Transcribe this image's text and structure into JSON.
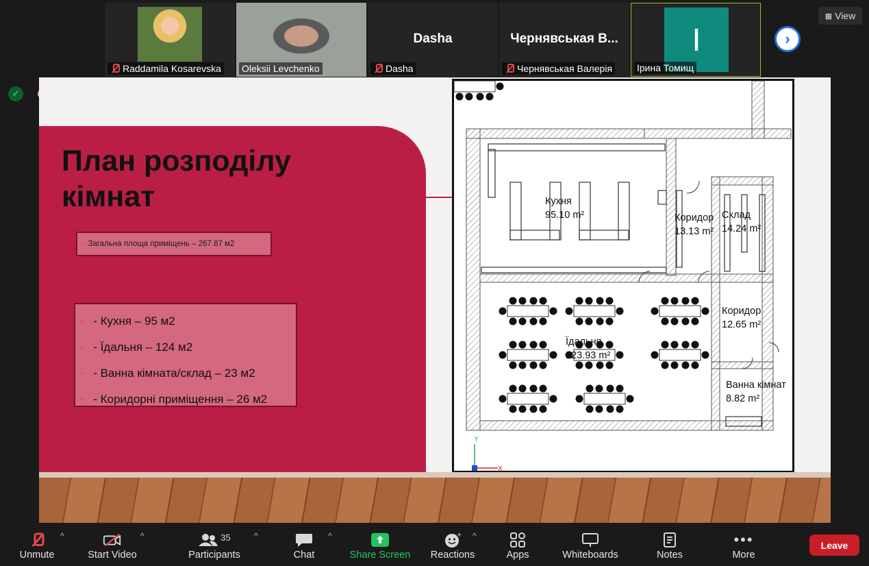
{
  "participants": [
    {
      "name": "Raddamila Kosarevska",
      "muted": true,
      "type": "video"
    },
    {
      "name": "Oleksii Levchenko",
      "muted": false,
      "type": "video"
    },
    {
      "name": "Dasha",
      "display_name": "Dasha",
      "muted": true,
      "type": "name"
    },
    {
      "name": "Чернявськая Валерія",
      "display_name": "Чернявськая В...",
      "muted": true,
      "type": "name"
    },
    {
      "name": "Ірина Томищ",
      "initial": "I",
      "muted": false,
      "type": "avatar",
      "active_speaker": true
    }
  ],
  "view_label": "View",
  "slide": {
    "title_line1": "План розподілу",
    "title_line2": "кімнат",
    "total_area": "Загальна площа приміщень – 267.87 м2",
    "rooms": [
      "- Кухня – 95 м2",
      "- Їдальня – 124 м2",
      "- Ванна кімната/склад – 23 м2",
      "- Коридорні приміщення – 26 м2"
    ],
    "plan_labels": {
      "kitchen": "Кухня",
      "kitchen_area": "95.10 m²",
      "corridor1": "Коридор",
      "corridor1_area": "13.13 m²",
      "storage": "Склад",
      "storage_area": "14.24 m²",
      "dining": "Їдальня",
      "dining_area": "123.93 m²",
      "corridor2": "Коридор",
      "corridor2_area": "12.65 m²",
      "bathroom": "Ванна кімнат",
      "bathroom_area": "8.82 m²",
      "axis_x": "X",
      "axis_y": "Y"
    }
  },
  "toolbar": {
    "unmute": "Unmute",
    "start_video": "Start Video",
    "participants": "Participants",
    "participants_count": "35",
    "chat": "Chat",
    "share_screen": "Share Screen",
    "reactions": "Reactions",
    "apps": "Apps",
    "whiteboards": "Whiteboards",
    "notes": "Notes",
    "more": "More",
    "leave": "Leave"
  },
  "colors": {
    "slide_red": "#bb1e45",
    "share_green": "#22c55e",
    "leave_red": "#c81e28",
    "active_border": "#9bbf2a",
    "avatar_teal": "#0f8b7e"
  }
}
